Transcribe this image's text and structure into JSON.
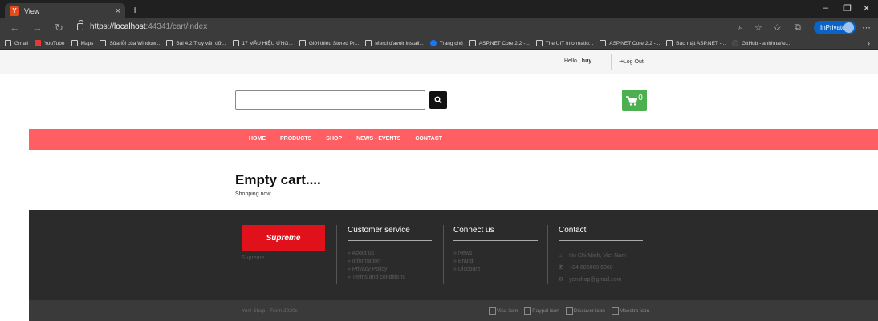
{
  "browser": {
    "tab_title": "View",
    "tab_close": "×",
    "new_tab": "+",
    "url_scheme": "https://",
    "url_host": "localhost",
    "url_path": ":44341/cart/index",
    "inprivate_label": "InPrivate",
    "window_controls": [
      "–",
      "❐",
      "✕"
    ],
    "bookmarks": [
      {
        "label": "Gmail",
        "icon": "page-icon"
      },
      {
        "label": "YouTube",
        "icon": "youtube-icon"
      },
      {
        "label": "Maps",
        "icon": "page-icon"
      },
      {
        "label": "Sửa lỗi của Window...",
        "icon": "page-icon"
      },
      {
        "label": "Bài 4.2 Truy vấn dữ...",
        "icon": "page-icon"
      },
      {
        "label": "17 MẪU HIỆU ỨNG...",
        "icon": "page-icon"
      },
      {
        "label": "Giới thiệu Stored Pr...",
        "icon": "page-icon"
      },
      {
        "label": "Merci d'avoir install...",
        "icon": "page-icon"
      },
      {
        "label": "Trang chủ",
        "icon": "facebook-icon"
      },
      {
        "label": "ASP.NET Core 2.2 -...",
        "icon": "page-icon"
      },
      {
        "label": "The UIT Informatio...",
        "icon": "page-icon"
      },
      {
        "label": "ASP.NET Core 2.2 -...",
        "icon": "page-icon"
      },
      {
        "label": "Bảo mật ASP.NET -...",
        "icon": "page-icon"
      },
      {
        "label": "GitHub - anhhna/le...",
        "icon": "github-icon"
      }
    ]
  },
  "header": {
    "greeting": "Hello ,",
    "username": "huy",
    "logout_label": "Log Out",
    "search_value": "",
    "cart_count": "0"
  },
  "nav": {
    "items": [
      "HOME",
      "PRODUCTS",
      "SHOP",
      "NEWS - EVENTS",
      "CONTACT"
    ]
  },
  "content": {
    "title": "Empty cart....",
    "link": "Shopping now"
  },
  "footer": {
    "brand_logo": "Supreme",
    "brand_name": "Supreme",
    "customer_service": {
      "title": "Customer service",
      "items": [
        "About us",
        "Information",
        "Privacy Policy",
        "Terms and conditions"
      ]
    },
    "connect_us": {
      "title": "Connect us",
      "items": [
        "News",
        "Brand",
        "Discount"
      ]
    },
    "contact": {
      "title": "Contact",
      "address": "Ho Chi Minh, Viet Nam",
      "phone": "+84 606060 6060",
      "email": "yenshop@gmail.com"
    },
    "copyright": "Yeni Shop - From 2020s",
    "payment_icons": [
      "Visa icon",
      "Paypal icon",
      "Discover icon",
      "Maestro icon"
    ]
  },
  "colors": {
    "nav_bg": "#ff5e63",
    "cart_green": "#4caf50",
    "brand_red": "#e1111c",
    "footer_bg": "#2b2b2b"
  }
}
